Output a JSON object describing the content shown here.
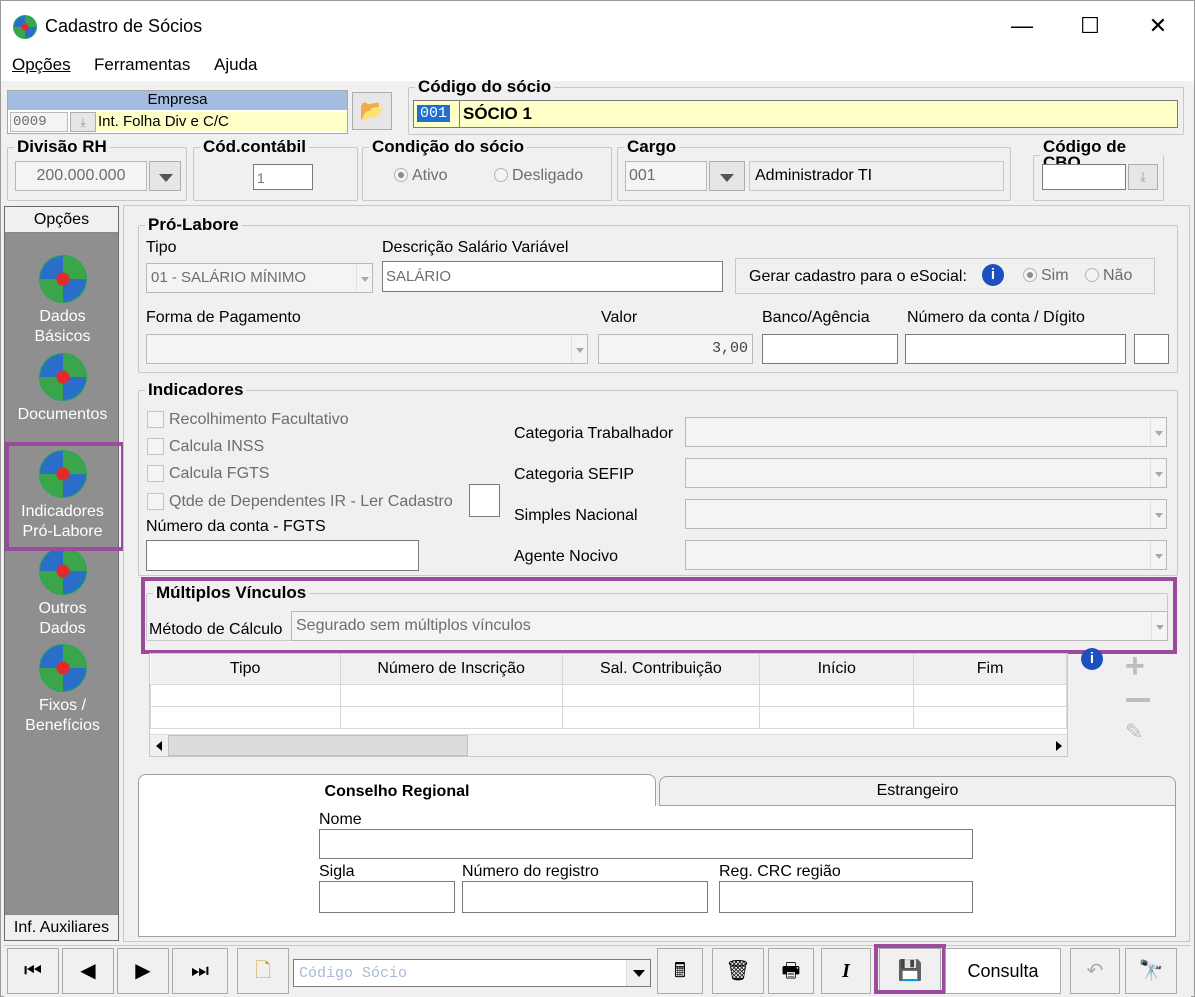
{
  "window": {
    "title": "Cadastro de Sócios",
    "min": "—",
    "max": "☐",
    "close": "✕"
  },
  "menu": {
    "opcoes": "Opções",
    "ferramentas": "Ferramentas",
    "ajuda": "Ajuda"
  },
  "empresa": {
    "header": "Empresa",
    "code": "0009",
    "name": "Int. Folha Div e C/C"
  },
  "codigo_socio": {
    "legend": "Código do sócio",
    "code": "001",
    "name": "SÓCIO 1"
  },
  "divisao": {
    "legend": "Divisão RH",
    "value": "200.000.000"
  },
  "cod_contabil": {
    "legend": "Cód.contábil",
    "value": "1"
  },
  "condicao": {
    "legend": "Condição do sócio",
    "ativo": "Ativo",
    "desligado": "Desligado"
  },
  "cargo": {
    "legend": "Cargo",
    "code": "001",
    "desc": "Administrador TI"
  },
  "cbo": {
    "legend": "Código de CBO",
    "value": ""
  },
  "sidebar": {
    "header": "Opções",
    "items": [
      "Dados Básicos",
      "Documentos",
      "Indicadores Pró-Labore",
      "Outros Dados",
      "Fixos / Benefícios"
    ],
    "footer": "Inf. Auxiliares"
  },
  "prolabore": {
    "legend": "Pró-Labore",
    "tipo_label": "Tipo",
    "tipo_value": "01 - SALÁRIO MÍNIMO",
    "desc_label": "Descrição Salário Variável",
    "desc_value": "SALÁRIO",
    "esocial_label": "Gerar cadastro para o eSocial:",
    "sim": "Sim",
    "nao": "Não",
    "forma_label": "Forma de Pagamento",
    "forma_value": "",
    "valor_label": "Valor",
    "valor_value": "3,00",
    "banco_label": "Banco/Agência",
    "conta_label": "Número da conta / Dígito"
  },
  "indicadores": {
    "legend": "Indicadores",
    "checks": [
      "Recolhimento Facultativo",
      "Calcula INSS",
      "Calcula FGTS",
      "Qtde de Dependentes IR - Ler Cadastro"
    ],
    "fgts_label": "Número da conta - FGTS",
    "categoria_trab": "Categoria Trabalhador",
    "categoria_sefip": "Categoria SEFIP",
    "simples": "Simples Nacional",
    "agente": "Agente Nocivo"
  },
  "multiplos": {
    "legend": "Múltiplos Vínculos",
    "metodo_label": "Método de Cálculo",
    "metodo_value": "Segurado sem múltiplos vínculos",
    "columns": [
      "Tipo",
      "Número de Inscrição",
      "Sal. Contribuição",
      "Início",
      "Fim"
    ]
  },
  "tabs": {
    "t1": "Conselho Regional",
    "t2": "Estrangeiro"
  },
  "conselho": {
    "nome": "Nome",
    "sigla": "Sigla",
    "registro": "Número do registro",
    "crc": "Reg. CRC região"
  },
  "toolbar": {
    "search_placeholder": "Código Sócio",
    "consulta": "Consulta"
  }
}
